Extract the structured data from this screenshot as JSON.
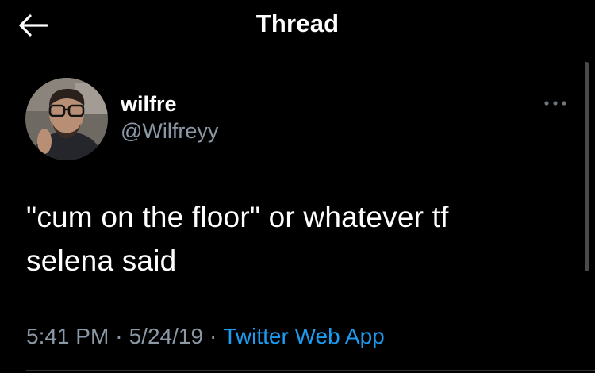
{
  "header": {
    "title": "Thread",
    "back_icon": "arrow-left-icon"
  },
  "author": {
    "display_name": "wilfre",
    "handle": "@Wilfreyy"
  },
  "menu": {
    "icon": "more-horizontal-icon"
  },
  "tweet": {
    "text_line1": "\"cum on the floor\" or whatever tf",
    "text_line2": "selena said"
  },
  "meta": {
    "time": "5:41 PM",
    "separator": "·",
    "date": "5/24/19",
    "source": "Twitter Web App"
  },
  "colors": {
    "background": "#000000",
    "text": "#ffffff",
    "secondary": "#8b98a5",
    "link": "#1d9bf0"
  }
}
